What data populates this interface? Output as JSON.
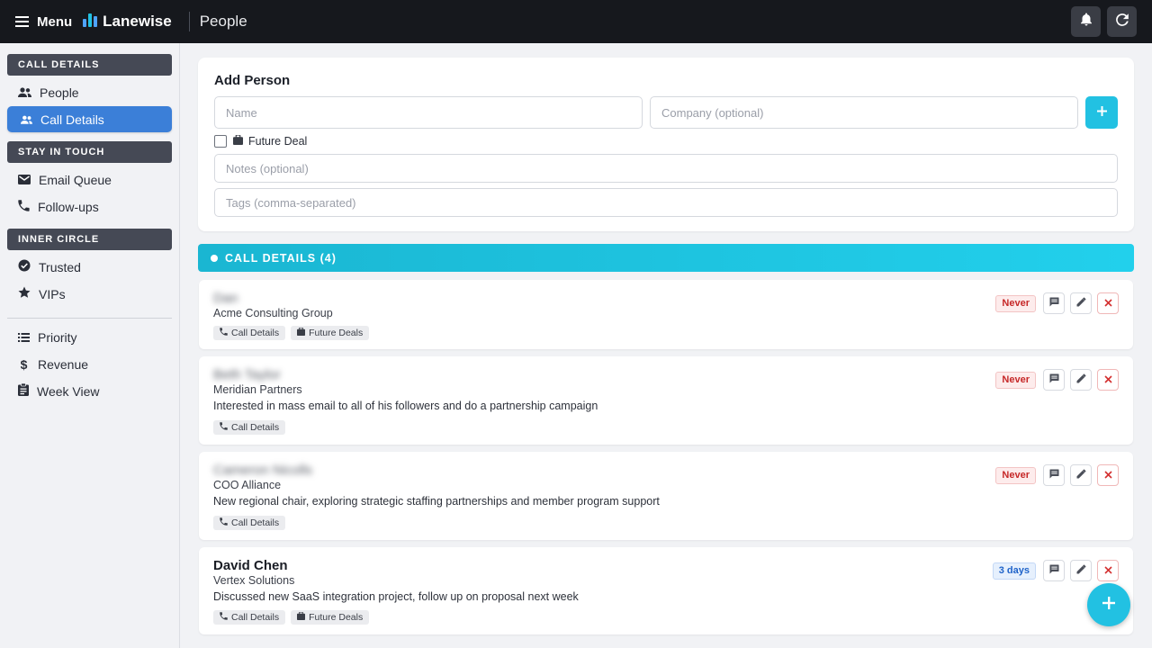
{
  "header": {
    "menu_label": "Menu",
    "app_name": "Lanewise",
    "page_title": "People",
    "icons": [
      "hamburger-icon",
      "logo-bars-icon",
      "bell-icon",
      "refresh-icon"
    ]
  },
  "sidebar": {
    "sections": [
      {
        "title": "CALL DETAILS",
        "items": [
          {
            "label": "People",
            "icon": "people-icon",
            "active": false
          },
          {
            "label": "Call Details",
            "icon": "people-icon",
            "active": true
          }
        ]
      },
      {
        "title": "STAY IN TOUCH",
        "items": [
          {
            "label": "Email Queue",
            "icon": "mail-icon",
            "active": false
          },
          {
            "label": "Follow-ups",
            "icon": "phone-icon",
            "active": false
          }
        ]
      },
      {
        "title": "INNER CIRCLE",
        "items": [
          {
            "label": "Trusted",
            "icon": "check-circle-icon",
            "active": false
          },
          {
            "label": "VIPs",
            "icon": "star-icon",
            "active": false
          }
        ]
      }
    ],
    "extra_items": [
      {
        "label": "Priority",
        "icon": "list-icon"
      },
      {
        "label": "Revenue",
        "icon": "dollar-icon"
      },
      {
        "label": "Week View",
        "icon": "clipboard-icon"
      }
    ]
  },
  "add_person": {
    "title": "Add Person",
    "name_placeholder": "Name",
    "company_placeholder": "Company (optional)",
    "future_deal_label": "Future Deal",
    "future_deal_checked": false,
    "notes_placeholder": "Notes (optional)",
    "tags_placeholder": "Tags (comma-separated)",
    "add_button": "+"
  },
  "section": {
    "title": "CALL DETAILS (4)"
  },
  "people": [
    {
      "name": "Dan",
      "name_blurred": true,
      "company": "Acme Consulting Group",
      "note": "",
      "tags": [
        {
          "label": "Call Details",
          "icon": "phone-icon"
        },
        {
          "label": "Future Deals",
          "icon": "briefcase-icon"
        }
      ],
      "status": "Never",
      "status_type": "never"
    },
    {
      "name": "Beth Taylor",
      "name_blurred": true,
      "company": "Meridian Partners",
      "note": "Interested in mass email to all of his followers and do a partnership campaign",
      "tags": [
        {
          "label": "Call Details",
          "icon": "phone-icon"
        }
      ],
      "status": "Never",
      "status_type": "never"
    },
    {
      "name": "Cameron Nicolls",
      "name_blurred": true,
      "company": "COO Alliance",
      "note": "New regional chair, exploring strategic staffing partnerships and member program support",
      "tags": [
        {
          "label": "Call Details",
          "icon": "phone-icon"
        }
      ],
      "status": "Never",
      "status_type": "never"
    },
    {
      "name": "David Chen",
      "name_blurred": false,
      "company": "Vertex Solutions",
      "note": "Discussed new SaaS integration project, follow up on proposal next week",
      "tags": [
        {
          "label": "Call Details",
          "icon": "phone-icon"
        },
        {
          "label": "Future Deals",
          "icon": "briefcase-icon"
        }
      ],
      "status": "3 days",
      "status_type": "days"
    }
  ],
  "fab": {
    "label": "+"
  },
  "colors": {
    "accent": "#22c1e2",
    "active_nav": "#3b7fd8",
    "topbar": "#16181d",
    "never": "#c62828",
    "days": "#1f63c9"
  }
}
